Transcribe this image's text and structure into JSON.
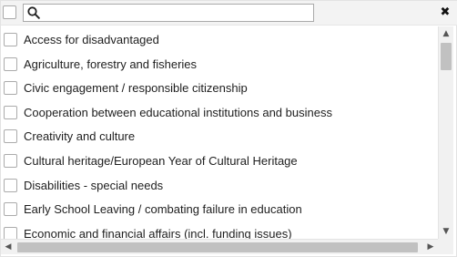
{
  "header": {
    "search": {
      "value": "",
      "placeholder": ""
    },
    "close_label": "✖"
  },
  "items": [
    {
      "label": "Access for disadvantaged",
      "checked": false
    },
    {
      "label": "Agriculture, forestry and fisheries",
      "checked": false
    },
    {
      "label": "Civic engagement / responsible citizenship",
      "checked": false
    },
    {
      "label": "Cooperation between educational institutions and business",
      "checked": false
    },
    {
      "label": "Creativity and culture",
      "checked": false
    },
    {
      "label": "Cultural heritage/European Year of Cultural Heritage",
      "checked": false
    },
    {
      "label": "Disabilities - special needs",
      "checked": false
    },
    {
      "label": "Early School Leaving / combating failure in education",
      "checked": false
    },
    {
      "label": "Economic and financial affairs (incl. funding issues)",
      "checked": false
    }
  ],
  "scrollbars": {
    "up_arrow": "▲",
    "down_arrow": "▼",
    "left_arrow": "◀",
    "right_arrow": "▶"
  }
}
